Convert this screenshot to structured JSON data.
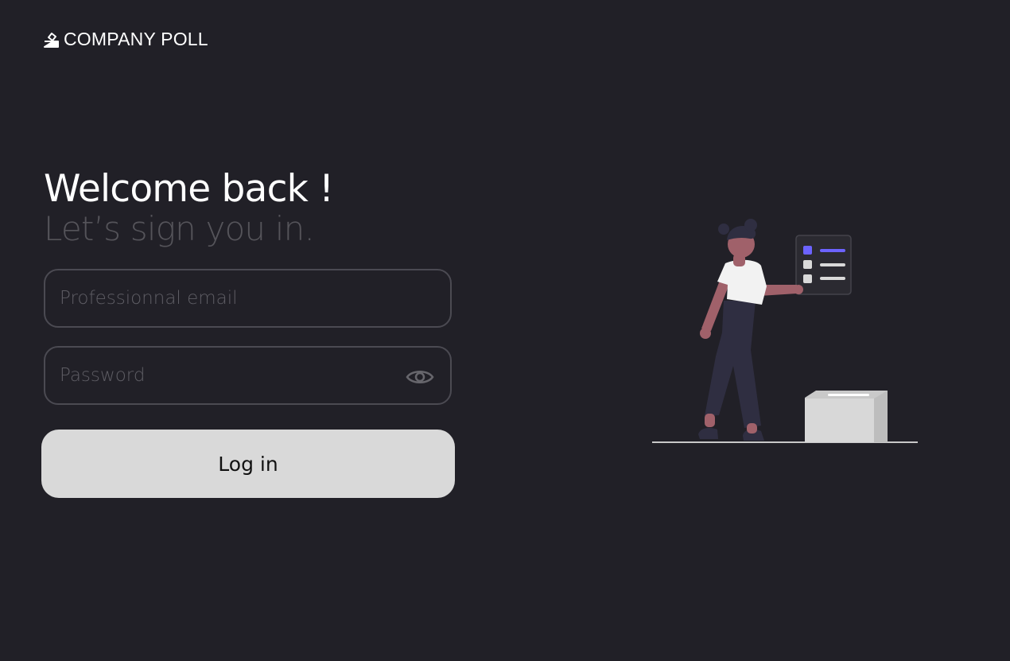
{
  "brand": {
    "name": "COMPANY POLL",
    "icon": "ballot-box-icon"
  },
  "hero": {
    "title": "Welcome back !",
    "subtitle": "Let’s sign you in."
  },
  "form": {
    "email": {
      "value": "",
      "placeholder": "Professionnal email"
    },
    "password": {
      "value": "",
      "placeholder": "Password",
      "toggle_icon": "eye-icon"
    },
    "login_label": "Log in"
  },
  "colors": {
    "background": "#212027",
    "accent": "#6c63ff",
    "button": "#d9d9d9"
  }
}
